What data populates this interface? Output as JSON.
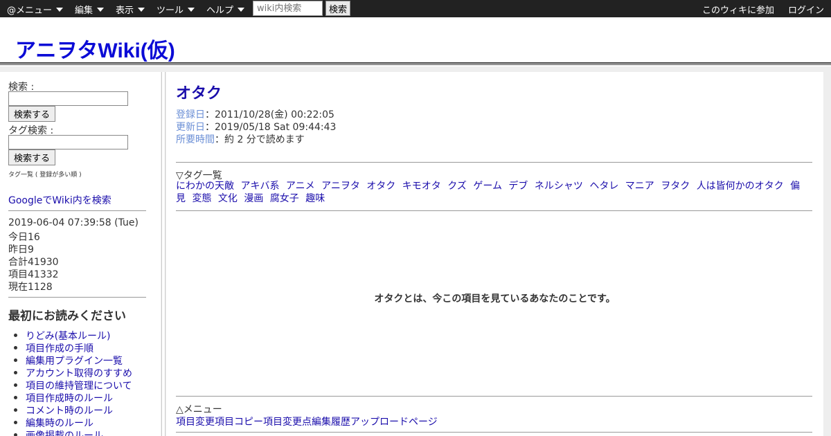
{
  "topbar": {
    "menus": [
      "@メニュー",
      "編集",
      "表示",
      "ツール",
      "ヘルプ"
    ],
    "search_placeholder": "wiki内検索",
    "search_button": "検索",
    "join": "このウィキに参加",
    "login": "ログイン"
  },
  "site": {
    "title": "アニヲタWiki(仮)"
  },
  "sidebar": {
    "search_label": "検索 :",
    "search_button": "検索する",
    "tag_search_label": "タグ検索 :",
    "tag_search_button": "検索する",
    "tag_list_small": "タグ一覧 ( 登録が多い順 )",
    "google_search": "GoogleでWiki内を検索",
    "datetime": "2019-06-04 07:39:58 (Tue)",
    "stats": [
      "今日16",
      "昨日9",
      "合計41930",
      "項目41332",
      "現在1128"
    ],
    "read_first_title": "最初にお読みください",
    "read_first_items": [
      "りどみ(基本ルール)",
      "項目作成の手順",
      "編集用プラグイン一覧",
      "アカウント取得のすすめ",
      "項目の維持管理について",
      "項目作成時のルール",
      "コメント時のルール",
      "編集時のルール",
      "画像掲載のルール"
    ]
  },
  "page": {
    "title": "オタク",
    "registered_label": "登録日",
    "registered_value": "：2011/10/28(金) 00:22:05",
    "updated_label": "更新日",
    "updated_value": "：2019/05/18 Sat 09:44:43",
    "time_label": "所要時間",
    "time_value": "：約 2 分で読めます",
    "tag_header": "▽タグ一覧",
    "tags": [
      "にわかの天敵",
      "アキバ系",
      "アニメ",
      "アニヲタ",
      "オタク",
      "キモオタ",
      "クズ",
      "ゲーム",
      "デブ",
      "ネルシャツ",
      "ヘタレ",
      "マニア",
      "ヲタク",
      "人は皆何かのオタク",
      "偏見",
      "変態",
      "文化",
      "漫画",
      "腐女子",
      "趣味"
    ],
    "body": "オタクとは、今この項目を見ているあなたのことです。",
    "menu_header": "△メニュー",
    "menu_links": [
      "項目変更",
      "項目コピー",
      "項目変更点",
      "編集履歴",
      "アップロード",
      "ページ"
    ]
  }
}
